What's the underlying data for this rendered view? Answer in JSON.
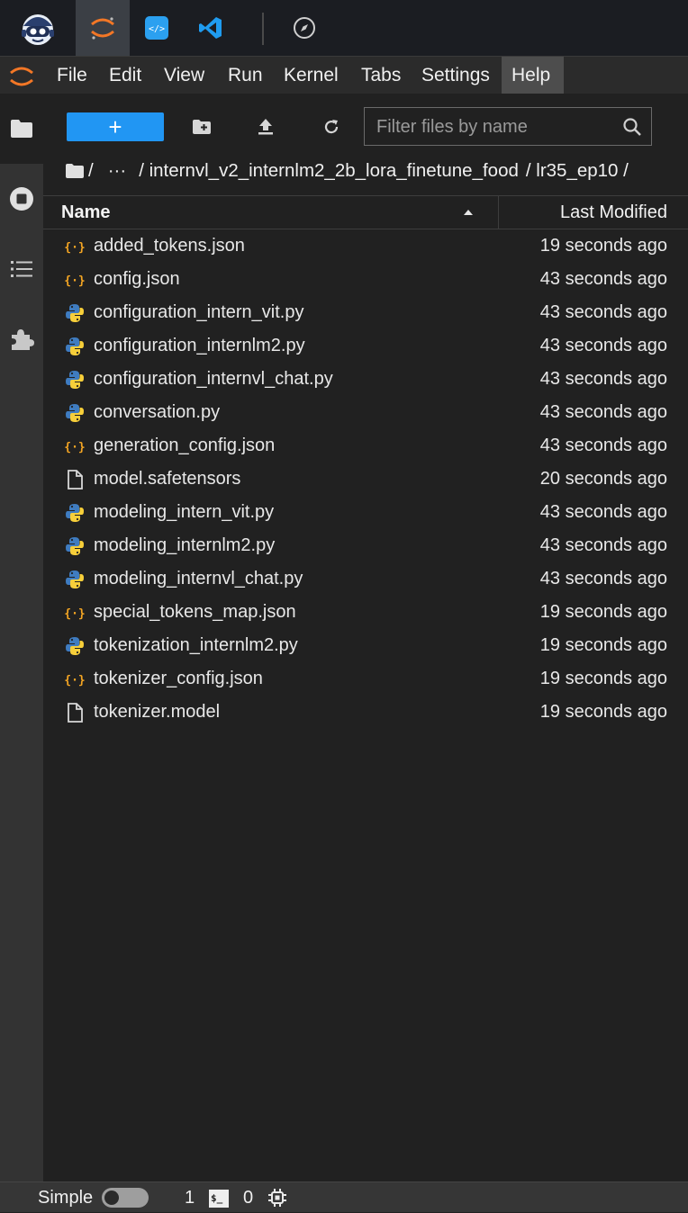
{
  "app_tabs": [
    {
      "icon": "bot-avatar-icon"
    },
    {
      "icon": "jupyter-icon",
      "active": true
    },
    {
      "icon": "code-editor-icon"
    },
    {
      "icon": "vscode-icon"
    },
    {
      "icon": "compass-icon"
    }
  ],
  "menubar": {
    "items": [
      "File",
      "Edit",
      "View",
      "Run",
      "Kernel",
      "Tabs",
      "Settings",
      "Help"
    ],
    "active": "Help"
  },
  "sidebar": {
    "items": [
      "folder-icon",
      "running-icon",
      "toc-icon",
      "extension-icon"
    ],
    "active": "folder-icon"
  },
  "toolbar": {
    "new_label": "+",
    "filter_placeholder": "Filter files by name"
  },
  "breadcrumb": {
    "root": "/",
    "ellipsis": "···",
    "segment1": "/ internvl_v2_internlm2_2b_lora_finetune_food",
    "segment2": "/ lr35_ep10 /"
  },
  "file_list": {
    "header_name": "Name",
    "header_modified": "Last Modified",
    "files": [
      {
        "name": "added_tokens.json",
        "modified": "19 seconds ago",
        "type": "json"
      },
      {
        "name": "config.json",
        "modified": "43 seconds ago",
        "type": "json"
      },
      {
        "name": "configuration_intern_vit.py",
        "modified": "43 seconds ago",
        "type": "python"
      },
      {
        "name": "configuration_internlm2.py",
        "modified": "43 seconds ago",
        "type": "python"
      },
      {
        "name": "configuration_internvl_chat.py",
        "modified": "43 seconds ago",
        "type": "python"
      },
      {
        "name": "conversation.py",
        "modified": "43 seconds ago",
        "type": "python"
      },
      {
        "name": "generation_config.json",
        "modified": "43 seconds ago",
        "type": "json"
      },
      {
        "name": "model.safetensors",
        "modified": "20 seconds ago",
        "type": "file"
      },
      {
        "name": "modeling_intern_vit.py",
        "modified": "43 seconds ago",
        "type": "python"
      },
      {
        "name": "modeling_internlm2.py",
        "modified": "43 seconds ago",
        "type": "python"
      },
      {
        "name": "modeling_internvl_chat.py",
        "modified": "43 seconds ago",
        "type": "python"
      },
      {
        "name": "special_tokens_map.json",
        "modified": "19 seconds ago",
        "type": "json"
      },
      {
        "name": "tokenization_internlm2.py",
        "modified": "19 seconds ago",
        "type": "python"
      },
      {
        "name": "tokenizer_config.json",
        "modified": "19 seconds ago",
        "type": "json"
      },
      {
        "name": "tokenizer.model",
        "modified": "19 seconds ago",
        "type": "file"
      }
    ]
  },
  "statusbar": {
    "simple_label": "Simple",
    "terminals_count": "1",
    "terminal_icon_text": "$_",
    "kernels_count": "0"
  },
  "colors": {
    "accent": "#2196f3",
    "json_icon": "#f5a623",
    "python_blue": "#3f7cc0",
    "python_yellow": "#f7cf3a",
    "jupyter_orange": "#f37726"
  }
}
